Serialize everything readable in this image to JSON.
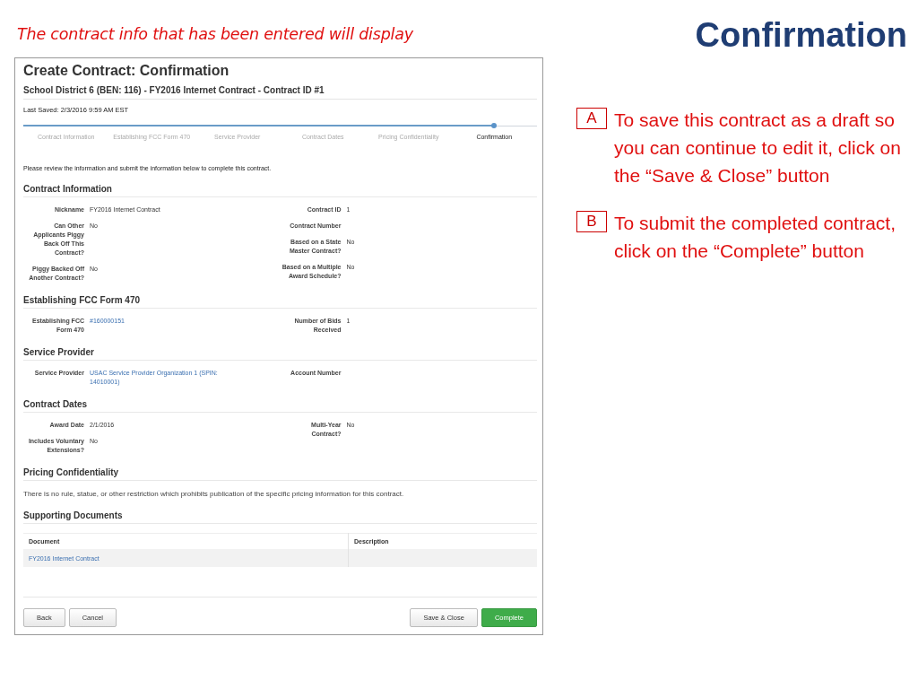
{
  "caption": "The contract info that has been entered will display",
  "slide_title": "Confirmation",
  "screen": {
    "title": "Create Contract: Confirmation",
    "subtitle": "School District 6 (BEN: 116) - FY2016 Internet Contract - Contract ID #1",
    "last_saved": "Last Saved: 2/3/2016 9:59 AM EST",
    "steps": [
      {
        "label": "Contract Information",
        "selected": false
      },
      {
        "label": "Establishing FCC Form 470",
        "selected": false
      },
      {
        "label": "Service Provider",
        "selected": false
      },
      {
        "label": "Contract Dates",
        "selected": false
      },
      {
        "label": "Pricing Confidentiality",
        "selected": false
      },
      {
        "label": "Confirmation",
        "selected": true
      }
    ],
    "intro": "Please review the information and submit the information below to complete this contract.",
    "sections": [
      {
        "kind": "fields",
        "title": "Contract Information",
        "left": [
          {
            "label": "Nickname",
            "value": "FY2016 Internet Contract",
            "link": false
          },
          {
            "label": "Can Other Applicants Piggy Back Off This Contract?",
            "value": "No",
            "link": false
          },
          {
            "label": "Piggy Backed Off Another Contract?",
            "value": "No",
            "link": false
          }
        ],
        "right": [
          {
            "label": "Contract ID",
            "value": "1",
            "link": false
          },
          {
            "label": "Contract Number"
          },
          {
            "label": "Based on a State Master Contract?",
            "value": "No",
            "link": false
          },
          {
            "label": "Based on a Multiple Award Schedule?",
            "value": "No",
            "link": false
          }
        ]
      },
      {
        "kind": "fields",
        "title": "Establishing FCC Form 470",
        "left": [
          {
            "label": "Establishing FCC Form 470",
            "value": "#160000151",
            "link": true
          }
        ],
        "right": [
          {
            "label": "Number of Bids Received",
            "value": "1",
            "link": false
          }
        ]
      },
      {
        "kind": "fields",
        "title": "Service Provider",
        "left": [
          {
            "label": "Service Provider",
            "value": "USAC Service Provider Organization 1 (SPIN: 14010001)",
            "link": true
          }
        ],
        "right": [
          {
            "label": "Account Number"
          }
        ]
      },
      {
        "kind": "fields",
        "title": "Contract Dates",
        "left": [
          {
            "label": "Award Date",
            "value": "2/1/2016",
            "link": false
          },
          {
            "label": "Includes Voluntary Extensions?",
            "value": "No",
            "link": false
          }
        ],
        "right": [
          {
            "label": "Multi-Year Contract?",
            "value": "No",
            "link": false
          }
        ]
      },
      {
        "kind": "text",
        "title": "Pricing Confidentiality",
        "text": "There is no rule, statue, or other restriction which prohibits publication of the specific pricing information for this contract."
      },
      {
        "kind": "table",
        "title": "Supporting Documents",
        "columns": [
          "Document",
          "Description"
        ],
        "rows": [
          [
            {
              "text": "FY2016 Internet Contract",
              "link": true
            }
          ]
        ]
      }
    ],
    "left_buttons": [
      {
        "label": "Back",
        "kind": "default"
      },
      {
        "label": "Cancel",
        "kind": "default"
      }
    ],
    "right_buttons": [
      {
        "label": "Save & Close",
        "kind": "default"
      },
      {
        "label": "Complete",
        "kind": "primary"
      }
    ]
  },
  "notes": [
    {
      "letter": "A",
      "text": "To save this contract as a draft so you can continue to edit it, click on the “Save & Close” button"
    },
    {
      "letter": "B",
      "text": "To submit the completed contract, click on the “Complete” button"
    }
  ]
}
